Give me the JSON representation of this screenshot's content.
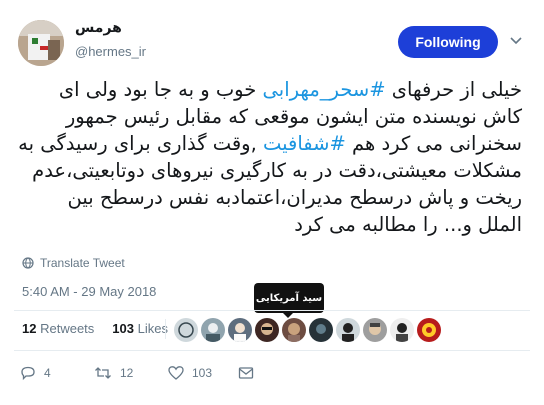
{
  "user": {
    "name": "هرمس",
    "handle": "@hermes_ir"
  },
  "follow_button": {
    "label": "Following"
  },
  "tweet": {
    "lines": [
      [
        {
          "t": "خیلی از حرفهای ",
          "h": false
        },
        {
          "t": "#سحر_مهرابی",
          "h": true
        },
        {
          "t": " خوب و به جا بود ولی ای",
          "h": false
        }
      ],
      [
        {
          "t": "کاش نویسنده متن ایشون موقعی که مقابل رئیس جمهور",
          "h": false
        }
      ],
      [
        {
          "t": "سخنرانی می کرد هم ",
          "h": false
        },
        {
          "t": "#شفافیت",
          "h": true
        },
        {
          "t": " ,وقت گذاری برای رسیدگی به",
          "h": false
        }
      ],
      [
        {
          "t": "مشکلات معیشتی،دقت در به کارگیری نیروهای دوتابعیتی،عدم",
          "h": false
        }
      ],
      [
        {
          "t": "ریخت و پاش درسطح مدیران،اعتمادبه نفس درسطح بین",
          "h": false
        }
      ],
      [
        {
          "t": "الملل و... را مطالبه می کرد",
          "h": false
        }
      ]
    ]
  },
  "translate_label": "Translate Tweet",
  "timestamp": "5:40 AM - 29 May 2018",
  "tooltip": "سید آمریکایی",
  "stats": {
    "retweets_count": "12",
    "retweets_label": "Retweets",
    "likes_count": "103",
    "likes_label": "Likes"
  },
  "actions": {
    "reply_count": "4",
    "retweet_count": "12",
    "like_count": "103"
  },
  "colors": {
    "accent": "#1d3fd8",
    "link": "#1b95e0",
    "muted": "#657786"
  }
}
